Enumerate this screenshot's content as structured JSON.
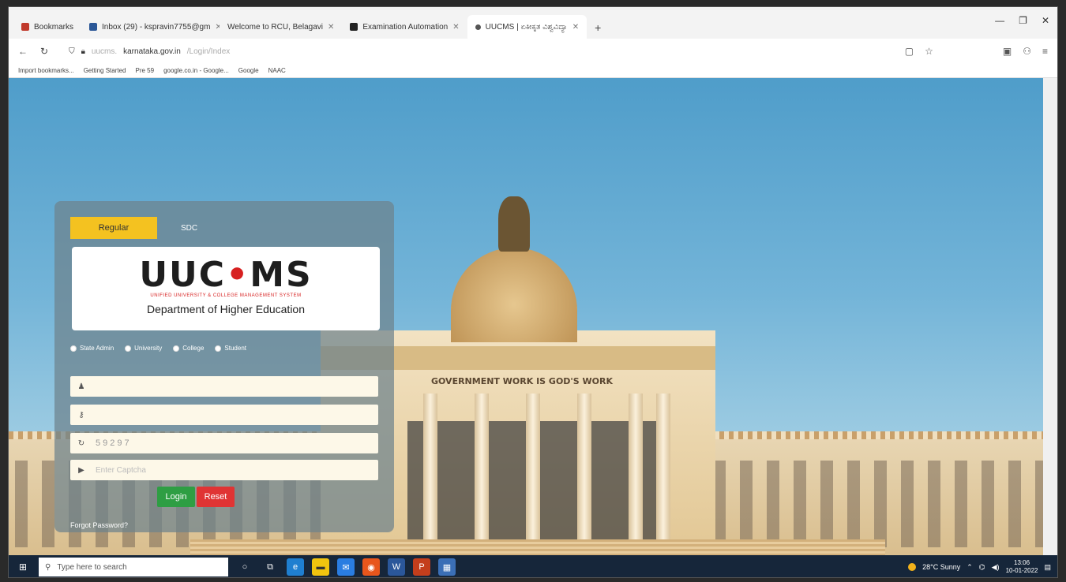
{
  "browser": {
    "tabs": [
      {
        "label": "Bookmarks",
        "active": false
      },
      {
        "label": "Inbox (29) - kspravin7755@gm",
        "active": false
      },
      {
        "label": "Welcome to RCU, Belagavi",
        "active": false
      },
      {
        "label": "Examination Automation",
        "active": false
      },
      {
        "label": "UUCMS | ಏಕೀಕೃತ ವಿಶ್ವವಿದ್ಯಾ",
        "active": true
      }
    ],
    "new_tab": "+",
    "window_controls": [
      "—",
      "❐",
      "✕"
    ],
    "url": "karnataka.gov.in",
    "url_dim_prefix": "uucms.",
    "url_dim_suffix": "/Login/Index",
    "bookmarks": [
      "Import bookmarks...",
      "Getting Started",
      "Pre 59",
      "google.co.in - Google...",
      "Google",
      "NAAC"
    ]
  },
  "login": {
    "tab_regular": "Regular",
    "tab_other": "SDC",
    "logo": {
      "prefix": "UUC",
      "accent": "•",
      "suffix": "MS",
      "subtitle": "UNIFIED UNIVERSITY & COLLEGE MANAGEMENT SYSTEM",
      "department": "Department of Higher Education"
    },
    "roles": [
      "State Admin",
      "University",
      "College",
      "Student"
    ],
    "username_value": "",
    "password_value": "",
    "captcha_value": "59297",
    "captcha_placeholder": "Enter Captcha",
    "login_button": "Login",
    "reset_button": "Reset",
    "forgot_password": "Forgot Password?"
  },
  "background": {
    "motto": "GOVERNMENT WORK IS GOD'S WORK"
  },
  "taskbar": {
    "search_placeholder": "Type here to search",
    "weather": "28°C Sunny",
    "time": "13:06",
    "date": "10-01-2022"
  },
  "colors": {
    "accent_yellow": "#f4c220",
    "login_green": "#2e9e43",
    "reset_red": "#e03434",
    "taskbar": "#16263a"
  }
}
